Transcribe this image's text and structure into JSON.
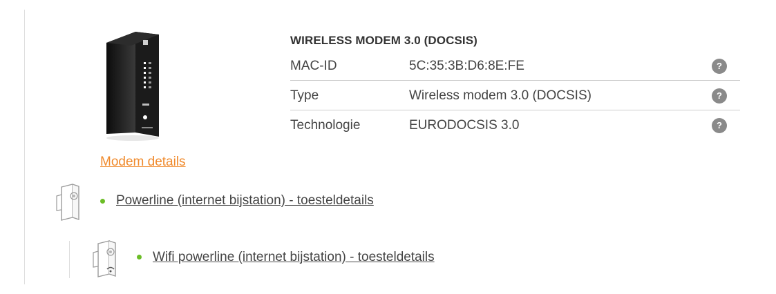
{
  "modem": {
    "icon": "cable-modem-image",
    "title": "WIRELESS MODEM 3.0 (DOCSIS)",
    "details_link": "Modem details",
    "specs": [
      {
        "label": "MAC-ID",
        "value": "5C:35:3B:D6:8E:FE",
        "help": "?"
      },
      {
        "label": "Type",
        "value": "Wireless modem 3.0 (DOCSIS)",
        "help": "?"
      },
      {
        "label": "Technologie",
        "value": "EURODOCSIS 3.0",
        "help": "?"
      }
    ]
  },
  "devices": [
    {
      "icon": "powerline-adapter-icon",
      "status": "connected",
      "link": "Powerline (internet bijstation) - toesteldetails"
    },
    {
      "icon": "wifi-powerline-adapter-icon",
      "status": "connected",
      "link": "Wifi powerline (internet bijstation) - toesteldetails"
    }
  ],
  "colors": {
    "accent_link": "#f08a2c",
    "status_green": "#6bbd26",
    "help_badge": "#8a8a8a",
    "separator": "#cccccc"
  }
}
